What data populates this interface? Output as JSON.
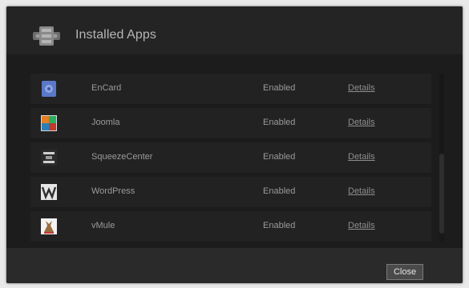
{
  "dialog": {
    "title": "Installed Apps",
    "title_icon": "apps-package-icon"
  },
  "apps": [
    {
      "name": "EnCard",
      "status": "Enabled",
      "details_label": "Details",
      "icon": "encard-app-icon"
    },
    {
      "name": "Joomla",
      "status": "Enabled",
      "details_label": "Details",
      "icon": "joomla-app-icon"
    },
    {
      "name": "SqueezeCenter",
      "status": "Enabled",
      "details_label": "Details",
      "icon": "squeezecenter-app-icon"
    },
    {
      "name": "WordPress",
      "status": "Enabled",
      "details_label": "Details",
      "icon": "wordpress-app-icon"
    },
    {
      "name": "vMule",
      "status": "Enabled",
      "details_label": "Details",
      "icon": "vmule-app-icon"
    }
  ],
  "footer": {
    "close_label": "Close"
  }
}
